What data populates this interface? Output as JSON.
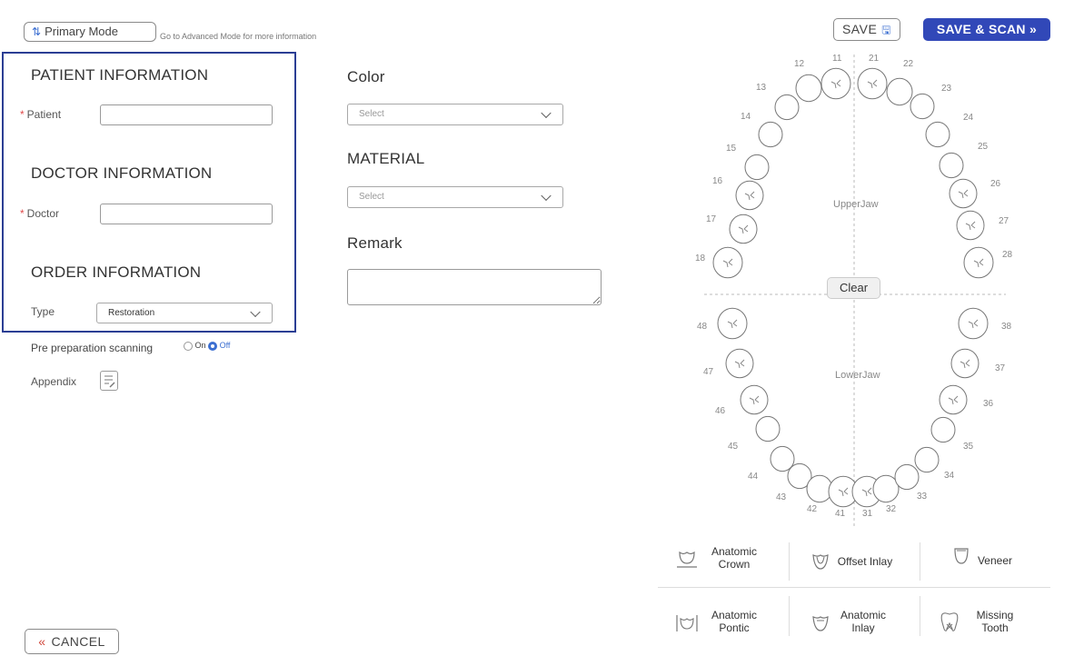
{
  "header": {
    "mode_button": "Primary Mode",
    "mode_hint": "Go to Advanced Mode for more information",
    "save_button": "SAVE",
    "save_scan_button": "SAVE & SCAN"
  },
  "patient_info": {
    "title": "PATIENT INFORMATION",
    "patient_label": "Patient",
    "patient_value": ""
  },
  "doctor_info": {
    "title": "DOCTOR INFORMATION",
    "doctor_label": "Doctor",
    "doctor_value": ""
  },
  "order_info": {
    "title": "ORDER INFORMATION",
    "type_label": "Type",
    "type_value": "Restoration"
  },
  "pre_scan": {
    "label": "Pre preparation scanning",
    "on_label": "On",
    "off_label": "Off",
    "selected": "Off"
  },
  "appendix": {
    "label": "Appendix"
  },
  "color": {
    "title": "Color",
    "select_placeholder": "Select"
  },
  "material": {
    "title": "MATERIAL",
    "select_placeholder": "Select"
  },
  "remark": {
    "title": "Remark",
    "value": ""
  },
  "chart": {
    "upper_jaw_label": "UpperJaw",
    "lower_jaw_label": "LowerJaw",
    "clear_button": "Clear",
    "teeth_upper": [
      "18",
      "17",
      "16",
      "15",
      "14",
      "13",
      "12",
      "11",
      "21",
      "22",
      "23",
      "24",
      "25",
      "26",
      "27",
      "28"
    ],
    "teeth_lower": [
      "48",
      "47",
      "46",
      "45",
      "44",
      "43",
      "42",
      "41",
      "31",
      "32",
      "33",
      "34",
      "35",
      "36",
      "37",
      "38"
    ]
  },
  "legend": [
    {
      "id": "anatomic-crown",
      "label_line1": "Anatomic",
      "label_line2": "Crown"
    },
    {
      "id": "offset-inlay",
      "label_line1": "Offset Inlay",
      "label_line2": ""
    },
    {
      "id": "veneer",
      "label_line1": "Veneer",
      "label_line2": ""
    },
    {
      "id": "anatomic-pontic",
      "label_line1": "Anatomic",
      "label_line2": "Pontic"
    },
    {
      "id": "anatomic-inlay",
      "label_line1": "Anatomic",
      "label_line2": "Inlay"
    },
    {
      "id": "missing-tooth",
      "label_line1": "Missing",
      "label_line2": "Tooth"
    }
  ],
  "footer": {
    "cancel_button": "CANCEL"
  },
  "colors": {
    "accent": "#3c6fd1",
    "primary_button": "#3148b8",
    "panel_border": "#2b3e94",
    "required": "#e04a4a"
  }
}
